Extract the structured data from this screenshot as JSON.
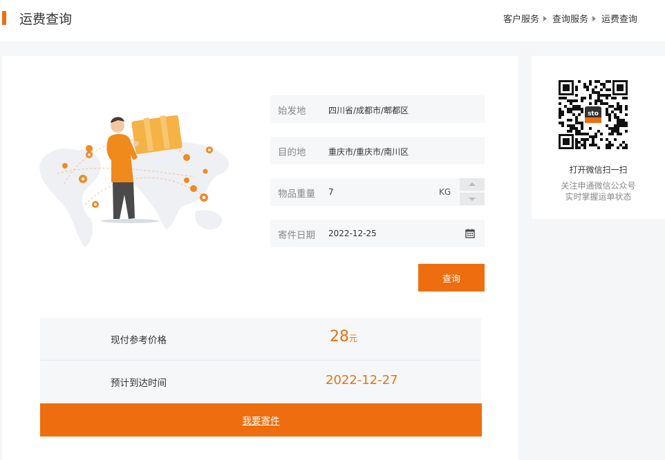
{
  "header": {
    "title": "运费查询",
    "breadcrumb": [
      "客户服务",
      "查询服务",
      "运费查询"
    ]
  },
  "form": {
    "origin": {
      "label": "始发地",
      "value": "四川省/成都市/郫都区"
    },
    "destination": {
      "label": "目的地",
      "value": "重庆市/重庆市/南川区"
    },
    "weight": {
      "label": "物品重量",
      "value": "7",
      "unit": "KG"
    },
    "send_date": {
      "label": "寄件日期",
      "value": "2022-12-25"
    },
    "query_button": "查询"
  },
  "results": {
    "price_label": "现付参考价格",
    "price_value": "28",
    "price_unit": "元",
    "arrival_label": "预计到达时间",
    "arrival_value": "2022-12-27",
    "ship_button": "我要寄件"
  },
  "qr": {
    "title": "打开微信扫一扫",
    "sub_line1": "关注申通微信公众号",
    "sub_line2": "实时掌握运单状态",
    "logo_text": "sto"
  },
  "colors": {
    "accent": "#ee6e0f",
    "price": "#e8720f",
    "field_bg": "#f6f7f9"
  }
}
